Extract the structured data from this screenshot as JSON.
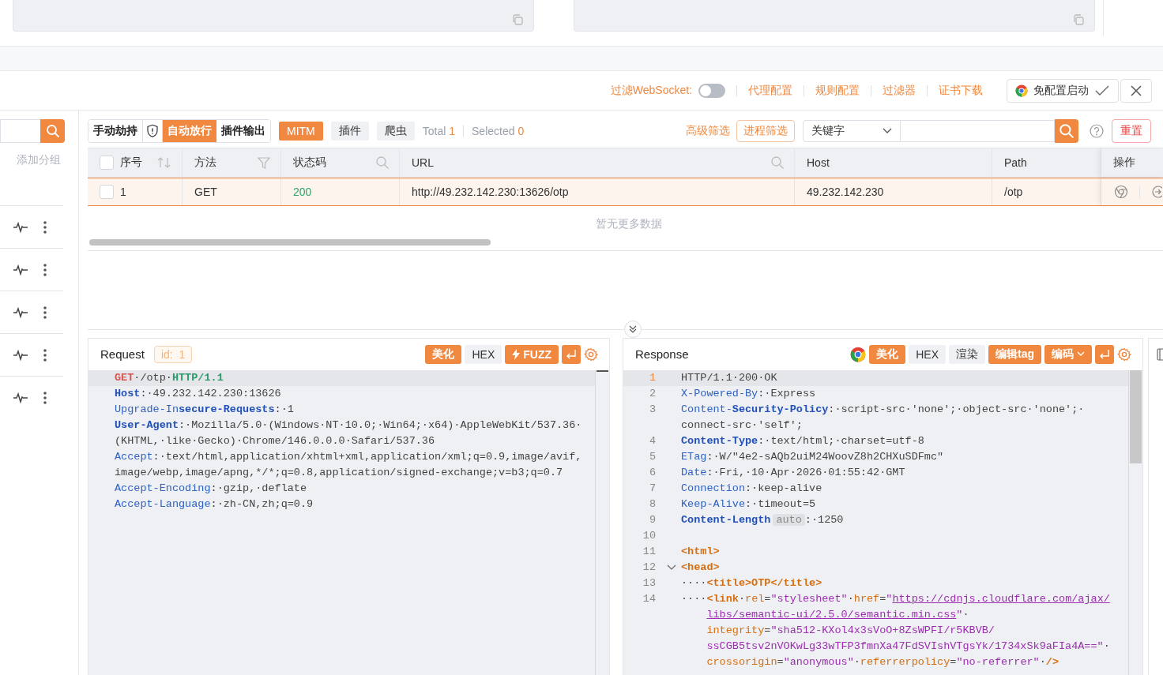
{
  "toolbar": {
    "websocket_filter": {
      "label": "过滤WebSocket:",
      "on": false
    },
    "links": [
      "代理配置",
      "规则配置",
      "过滤器",
      "证书下载"
    ],
    "launch_button": "免配置启动"
  },
  "sidebar": {
    "add_group": "添加分组"
  },
  "mode_tabs": [
    {
      "label": "手动劫持",
      "selected": false
    },
    {
      "label": "自动放行",
      "selected": true
    },
    {
      "label": "插件输出",
      "selected": false
    }
  ],
  "filters": [
    {
      "label": "MITM",
      "selected": true
    },
    {
      "label": "插件",
      "selected": false
    },
    {
      "label": "爬虫",
      "selected": false
    }
  ],
  "counts": {
    "total_label": "Total",
    "total": "1",
    "selected_label": "Selected",
    "selected": "0"
  },
  "search": {
    "advanced": "高级筛选",
    "process": "进程筛选",
    "field_type": "关键字",
    "reset": "重置"
  },
  "table": {
    "header_checked": false,
    "columns": [
      "序号",
      "方法",
      "状态码",
      "URL",
      "Host",
      "Path",
      "操作"
    ],
    "rows": [
      {
        "selected": true,
        "checked": false,
        "cells": [
          "1",
          "GET",
          "200",
          "http://49.232.142.230:13626/otp",
          "49.232.142.230",
          "/otp"
        ]
      }
    ],
    "empty_text": "暂无更多数据"
  },
  "request": {
    "title": "Request",
    "id": "id:  1",
    "buttons": [
      {
        "kind": "primary",
        "label": "美化"
      },
      {
        "kind": "plain",
        "label": "HEX"
      },
      {
        "kind": "fuzz",
        "label": "FUZZ"
      }
    ],
    "lines": [
      {
        "current": true,
        "tokens": [
          {
            "kind": "method",
            "text": "GET"
          },
          {
            "kind": "plain",
            "text": "·/otp·"
          },
          {
            "kind": "version",
            "text": "HTTP/1.1"
          }
        ]
      },
      {
        "current": false,
        "tokens": [
          {
            "kind": "keyb",
            "text": "Host"
          },
          {
            "kind": "plain",
            "text": ":·49.232.142.230:13626"
          }
        ]
      },
      {
        "current": false,
        "tokens": [
          {
            "kind": "key",
            "text": "Upgrade-In"
          },
          {
            "kind": "keyb",
            "text": "secure-Requests"
          },
          {
            "kind": "plain",
            "text": ":·1"
          }
        ]
      },
      {
        "current": false,
        "tokens": [
          {
            "kind": "keyb",
            "text": "User-Agent"
          },
          {
            "kind": "plain",
            "text": ":·Mozilla/5.0·(Windows·NT·10.0;·Win64;·x64)·AppleWebKit/537.36·"
          },
          {
            "kind": "wrap"
          },
          {
            "kind": "plain",
            "text": "(KHTML,·like·Gecko)·Chrome/146.0.0.0·Safari/537.36"
          }
        ]
      },
      {
        "current": false,
        "tokens": [
          {
            "kind": "key",
            "text": "Accept"
          },
          {
            "kind": "plain",
            "text": ":·text/html,application/xhtml+xml,application/xml;q=0.9,image/avif,"
          },
          {
            "kind": "wrap"
          },
          {
            "kind": "plain",
            "text": "image/webp,image/apng,*/*;q=0.8,application/signed-exchange;v=b3;q=0.7"
          }
        ]
      },
      {
        "current": false,
        "tokens": [
          {
            "kind": "key",
            "text": "Accept-Encoding"
          },
          {
            "kind": "plain",
            "text": ":·gzip,·deflate"
          }
        ]
      },
      {
        "current": false,
        "tokens": [
          {
            "kind": "key",
            "text": "Accept-Language"
          },
          {
            "kind": "plain",
            "text": ":·zh-CN,zh;q=0.9"
          }
        ]
      }
    ]
  },
  "response": {
    "title": "Response",
    "buttons": [
      {
        "kind": "primary",
        "label": "美化"
      },
      {
        "kind": "plain",
        "label": "HEX"
      },
      {
        "kind": "plain",
        "label": "渲染"
      },
      {
        "kind": "primary",
        "label": "编辑tag"
      },
      {
        "kind": "dropdown",
        "label": "编码"
      }
    ],
    "lines": [
      {
        "number": "1",
        "current": true,
        "tokens": [
          {
            "kind": "plain",
            "text": "HTTP/1.1·200·OK"
          }
        ]
      },
      {
        "number": "2",
        "current": false,
        "tokens": [
          {
            "kind": "key",
            "text": "X-Powered-By"
          },
          {
            "kind": "plain",
            "text": ":·Express"
          }
        ]
      },
      {
        "number": "3",
        "current": false,
        "tokens": [
          {
            "kind": "key",
            "text": "Content-"
          },
          {
            "kind": "keyb",
            "text": "Security-Policy"
          },
          {
            "kind": "plain",
            "text": ":·script-src·'none';·object-src·'none';·"
          },
          {
            "kind": "wrap"
          },
          {
            "kind": "plain",
            "text": "connect-src·'self';"
          }
        ]
      },
      {
        "number": "4",
        "current": false,
        "tokens": [
          {
            "kind": "keyb",
            "text": "Content-Type"
          },
          {
            "kind": "plain",
            "text": ":·text/html;·charset=utf-8"
          }
        ]
      },
      {
        "number": "5",
        "current": false,
        "tokens": [
          {
            "kind": "key",
            "text": "ETag"
          },
          {
            "kind": "plain",
            "text": ":·W/\"4e2-sAQb2uiM24WoovZ8h2CHXuSDFmc\""
          }
        ]
      },
      {
        "number": "6",
        "current": false,
        "tokens": [
          {
            "kind": "key",
            "text": "Date"
          },
          {
            "kind": "plain",
            "text": ":·Fri,·10·Apr·2026·01:55:42·GMT"
          }
        ]
      },
      {
        "number": "7",
        "current": false,
        "tokens": [
          {
            "kind": "key",
            "text": "Connection"
          },
          {
            "kind": "plain",
            "text": ":·keep-alive"
          }
        ]
      },
      {
        "number": "8",
        "current": false,
        "tokens": [
          {
            "kind": "key",
            "text": "Keep-Alive"
          },
          {
            "kind": "plain",
            "text": ":·timeout=5"
          }
        ]
      },
      {
        "number": "9",
        "current": false,
        "tokens": [
          {
            "kind": "keyb",
            "text": "Content-Length"
          },
          {
            "kind": "badge",
            "text": "auto"
          },
          {
            "kind": "plain",
            "text": ":·1250"
          }
        ]
      },
      {
        "number": "10",
        "current": false
      },
      {
        "number": "11",
        "current": false,
        "tokens": [
          {
            "kind": "tag",
            "text": "<html>"
          }
        ]
      },
      {
        "number": "12",
        "current": false,
        "foldable": true,
        "tokens": [
          {
            "kind": "tag",
            "text": "<head>"
          }
        ]
      },
      {
        "number": "13",
        "current": false,
        "tokens": [
          {
            "kind": "plain",
            "text": "····"
          },
          {
            "kind": "tag",
            "text": "<title>OTP</title>"
          }
        ]
      },
      {
        "number": "14",
        "current": false,
        "tokens": [
          {
            "kind": "plain",
            "text": "····"
          },
          {
            "kind": "tag",
            "text": "<link"
          },
          {
            "kind": "plain",
            "text": "·"
          },
          {
            "kind": "attr",
            "text": "rel"
          },
          {
            "kind": "plain",
            "text": "="
          },
          {
            "kind": "str",
            "text": "\"stylesheet\""
          },
          {
            "kind": "plain",
            "text": "·"
          },
          {
            "kind": "attr",
            "text": "href"
          },
          {
            "kind": "plain",
            "text": "="
          },
          {
            "kind": "str",
            "text": "\""
          },
          {
            "kind": "url",
            "text": "https://cdnjs.cloudflare.com/ajax/"
          },
          {
            "kind": "wrap"
          },
          {
            "kind": "url",
            "text": "libs/semantic-ui/2.5.0/semantic.min.css"
          },
          {
            "kind": "str",
            "text": "\""
          },
          {
            "kind": "plain",
            "text": "·"
          },
          {
            "kind": "wrap"
          },
          {
            "kind": "attr",
            "text": "integrity"
          },
          {
            "kind": "plain",
            "text": "="
          },
          {
            "kind": "str",
            "text": "\"sha512-KXol4x3sVoO+8ZsWPFI/r5KBVB/"
          },
          {
            "kind": "wrap"
          },
          {
            "kind": "str",
            "text": "ssCGB5tsv2nVOKwLg33wTFP3fmnXa47FdSVIshVTgsYk/1734xSk9aFIa4A==\""
          },
          {
            "kind": "plain",
            "text": "·"
          },
          {
            "kind": "wrap"
          },
          {
            "kind": "attr",
            "text": "crossorigin"
          },
          {
            "kind": "plain",
            "text": "="
          },
          {
            "kind": "str",
            "text": "\"anonymous\""
          },
          {
            "kind": "plain",
            "text": "·"
          },
          {
            "kind": "attr",
            "text": "referrerpolicy"
          },
          {
            "kind": "plain",
            "text": "="
          },
          {
            "kind": "str",
            "text": "\"no-referrer\""
          },
          {
            "kind": "plain",
            "text": "·"
          },
          {
            "kind": "tag",
            "text": "/>"
          }
        ]
      }
    ]
  }
}
